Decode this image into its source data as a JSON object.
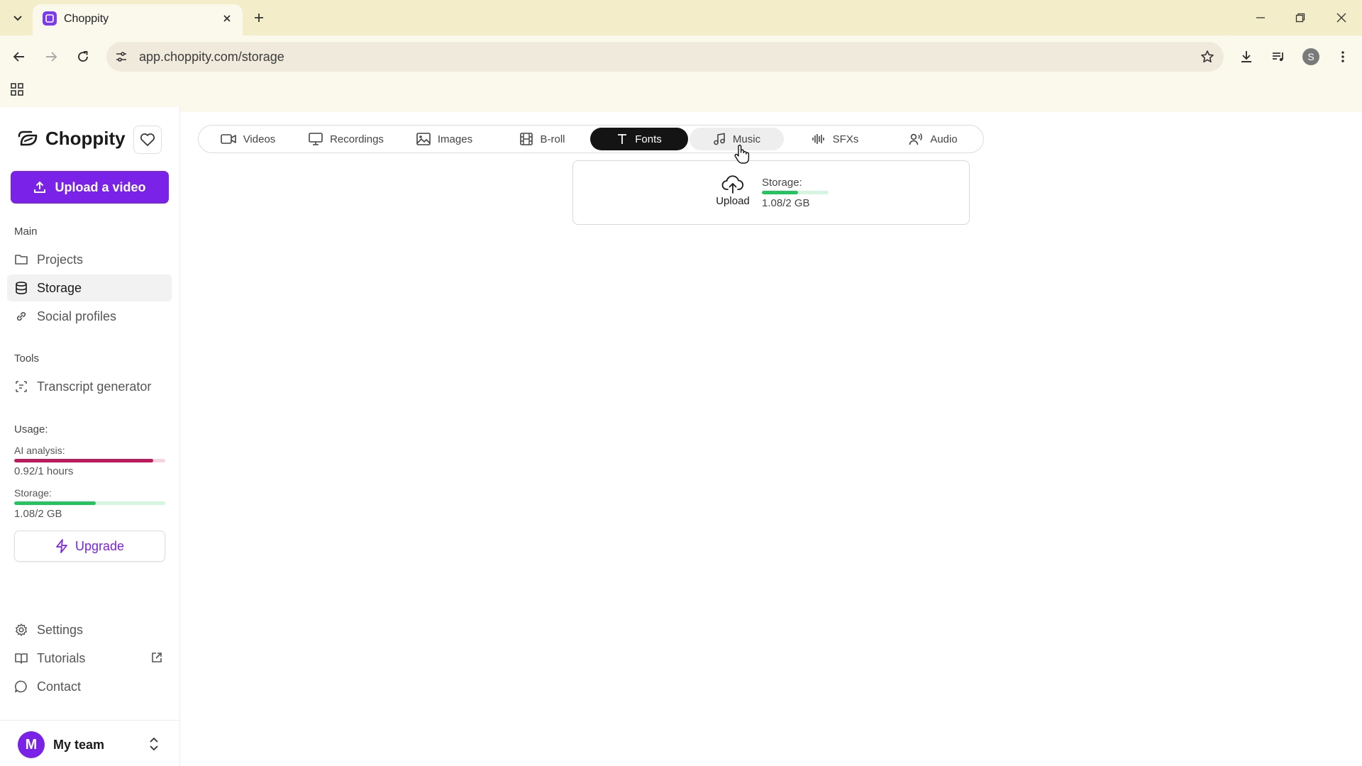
{
  "browser": {
    "tab_title": "Choppity",
    "url": "app.choppity.com/storage",
    "profile_initial": "S"
  },
  "app": {
    "brand_name": "Choppity",
    "accent_color": "#7b22e8",
    "upload_button": "Upload a video",
    "sections": {
      "main": "Main",
      "tools": "Tools",
      "usage": "Usage:"
    },
    "nav_main": [
      {
        "label": "Projects",
        "icon": "folder-icon"
      },
      {
        "label": "Storage",
        "icon": "database-icon"
      },
      {
        "label": "Social profiles",
        "icon": "link-icon"
      }
    ],
    "nav_tools": [
      {
        "label": "Transcript generator",
        "icon": "transcript-icon"
      }
    ],
    "usage": {
      "ai_analysis_label": "AI analysis:",
      "ai_analysis_value": "0.92/1 hours",
      "ai_analysis_fraction": 0.92,
      "ai_color": "#c2185b",
      "storage_label": "Storage:",
      "storage_value": "1.08/2 GB",
      "storage_fraction": 0.54,
      "storage_color": "#22c55e"
    },
    "upgrade_button": "Upgrade",
    "nav_bottom": [
      {
        "label": "Settings",
        "icon": "gear-icon"
      },
      {
        "label": "Tutorials",
        "icon": "book-icon"
      },
      {
        "label": "Contact",
        "icon": "chat-icon"
      }
    ],
    "team": {
      "initial": "M",
      "name": "My team"
    }
  },
  "storage_tabs": [
    {
      "label": "Videos",
      "icon": "video-icon"
    },
    {
      "label": "Recordings",
      "icon": "monitor-icon"
    },
    {
      "label": "Images",
      "icon": "image-icon"
    },
    {
      "label": "B-roll",
      "icon": "film-icon"
    },
    {
      "label": "Fonts",
      "icon": "type-icon",
      "active": true
    },
    {
      "label": "Music",
      "icon": "music-icon",
      "hover": true
    },
    {
      "label": "SFXs",
      "icon": "waveform-icon"
    },
    {
      "label": "Audio",
      "icon": "voice-icon"
    }
  ],
  "storage_card": {
    "upload_label": "Upload",
    "storage_label": "Storage:",
    "storage_value": "1.08/2 GB",
    "storage_fraction": 0.54
  }
}
